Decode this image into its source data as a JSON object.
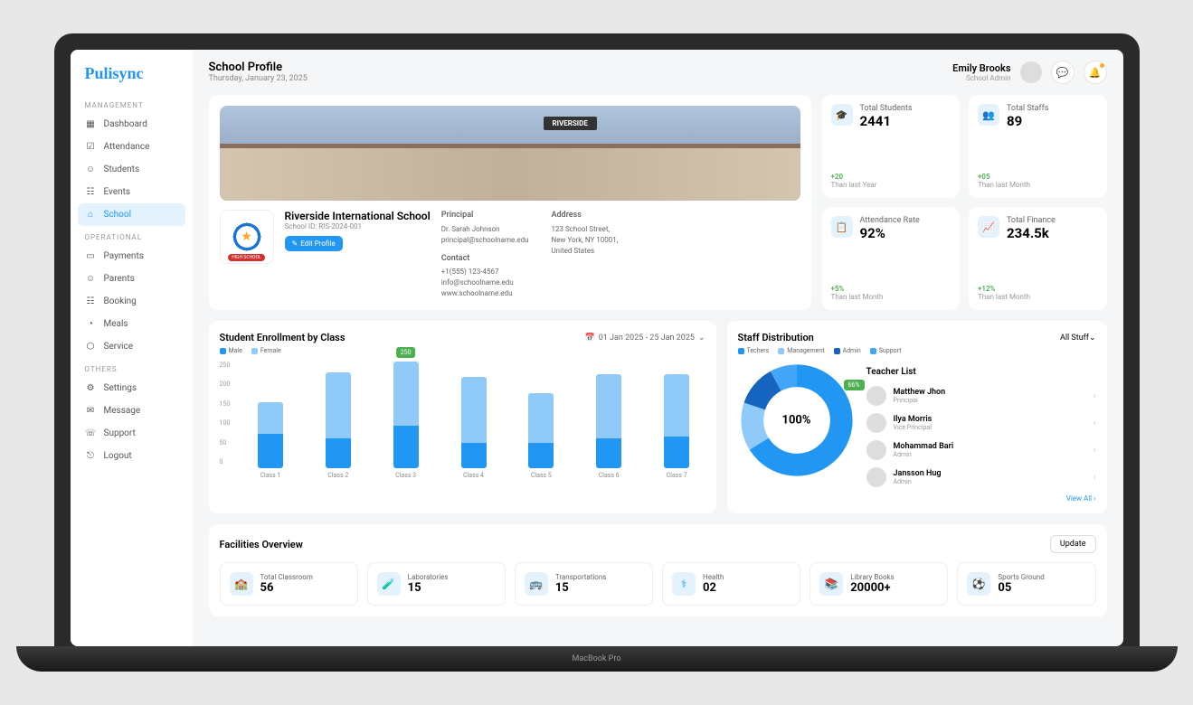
{
  "brand": "Pulisync",
  "nav": {
    "groups": [
      {
        "label": "MANAGEMENT",
        "items": [
          "Dashboard",
          "Attendance",
          "Students",
          "Events",
          "School"
        ]
      },
      {
        "label": "OPERATIONAL",
        "items": [
          "Payments",
          "Parents",
          "Booking",
          "Meals",
          "Service"
        ]
      },
      {
        "label": "OTHERS",
        "items": [
          "Settings",
          "Message",
          "Support",
          "Logout"
        ]
      }
    ],
    "active": "School"
  },
  "header": {
    "title": "School Profile",
    "date": "Thursday, January 23, 2025",
    "user": {
      "name": "Emily Brooks",
      "role": "School Admin"
    }
  },
  "school": {
    "banner_sign": "RIVERSIDE",
    "logo_ribbon": "HIGH SCHOOL",
    "name": "Riverside International School",
    "id": "School ID: RIS-2024-001",
    "edit_label": "Edit Profile",
    "principal": {
      "label": "Principal",
      "name": "Dr. Sarah Johnson",
      "email": "principal@schoolname.edu"
    },
    "contact": {
      "label": "Contact",
      "phone": "+1(555) 123-4567",
      "email": "info@schoolname.edu",
      "site": "www.schoolname.edu"
    },
    "address": {
      "label": "Address",
      "line1": "123 School Street,",
      "line2": "New York, NY 10001,",
      "line3": "United States"
    }
  },
  "stats": [
    {
      "label": "Total Students",
      "value": "2441",
      "delta": "+20",
      "sub": "Than last Year"
    },
    {
      "label": "Total Staffs",
      "value": "89",
      "delta": "+05",
      "sub": "Than last Month"
    },
    {
      "label": "Attendance Rate",
      "value": "92%",
      "delta": "+5%",
      "sub": "Than last Month"
    },
    {
      "label": "Total Finance",
      "value": "234.5k",
      "delta": "+12%",
      "sub": "Than last Month"
    }
  ],
  "enrollment": {
    "title": "Student Enrollment by Class",
    "range": "01 Jan 2025 - 25 Jan 2025",
    "legend": [
      "Male",
      "Female"
    ],
    "badge": "250"
  },
  "staff": {
    "title": "Staff Distribution",
    "filter": "All Stuff",
    "legend": [
      "Techers",
      "Management",
      "Admin",
      "Support"
    ],
    "center": "100%",
    "badge": "66%",
    "list_title": "Teacher List",
    "teachers": [
      {
        "name": "Matthew Jhon",
        "role": "Principal"
      },
      {
        "name": "Ilya Morris",
        "role": "Vice Principal"
      },
      {
        "name": "Mohammad Bari",
        "role": "Admin"
      },
      {
        "name": "Jansson Hug",
        "role": "Admin"
      }
    ],
    "view_all": "View All"
  },
  "facilities": {
    "title": "Facilities Overview",
    "update": "Update",
    "items": [
      {
        "label": "Total Classroom",
        "value": "56"
      },
      {
        "label": "Laboratories",
        "value": "15"
      },
      {
        "label": "Transportations",
        "value": "15"
      },
      {
        "label": "Health",
        "value": "02"
      },
      {
        "label": "Library Books",
        "value": "20000+"
      },
      {
        "label": "Sports Ground",
        "value": "05"
      }
    ]
  },
  "chart_data": {
    "type": "bar",
    "title": "Student Enrollment by Class",
    "categories": [
      "Class 1",
      "Class 2",
      "Class 3",
      "Class 4",
      "Class 5",
      "Class 6",
      "Class 7"
    ],
    "series": [
      {
        "name": "Male",
        "values": [
          80,
          70,
          100,
          60,
          60,
          70,
          75
        ]
      },
      {
        "name": "Female",
        "values": [
          75,
          155,
          150,
          155,
          115,
          150,
          145
        ]
      }
    ],
    "ylim": [
      0,
      250
    ],
    "y_ticks": [
      0,
      50,
      100,
      150,
      200,
      250
    ],
    "highlighted": {
      "category": "Class 3",
      "total": 250
    }
  },
  "donut_data": {
    "type": "pie",
    "title": "Staff Distribution",
    "series": [
      {
        "name": "Techers",
        "value": 66,
        "color": "#2196f3"
      },
      {
        "name": "Management",
        "value": 14,
        "color": "#90caf9"
      },
      {
        "name": "Admin",
        "value": 12,
        "color": "#1565c0"
      },
      {
        "name": "Support",
        "value": 8,
        "color": "#42a5f5"
      }
    ],
    "center_label": "100%"
  },
  "device": "MacBook Pro"
}
